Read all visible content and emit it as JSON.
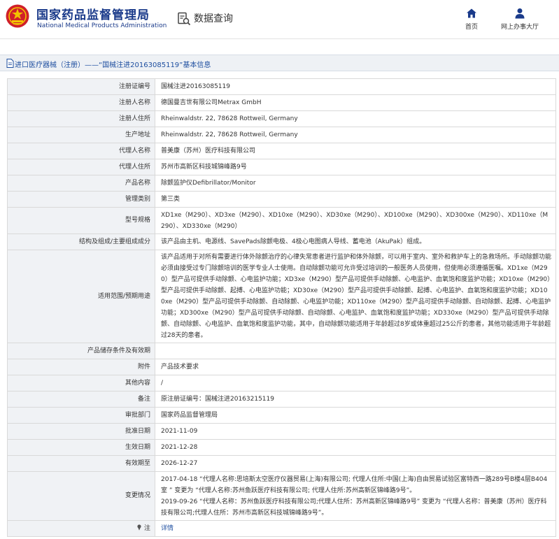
{
  "header": {
    "brand_cn": "国家药品监督管理局",
    "brand_en": "National Medical Products Administration",
    "query_title": "数据查询",
    "nav": [
      {
        "label": "首页",
        "icon": "home-icon"
      },
      {
        "label": "网上办事大厅",
        "icon": "user-icon"
      }
    ]
  },
  "title_bar": {
    "text": "进口医疗器械（注册）——“国械注进20163085119”基本信息"
  },
  "colors": {
    "brand": "#1a3a8a",
    "link": "#1f4fa0",
    "label_bg": "#f0f2f5",
    "border": "#d9d9d9",
    "logo_red": "#d0202a"
  },
  "rows": [
    {
      "label": "注册证编号",
      "value": "国械注进20163085119"
    },
    {
      "label": "注册人名称",
      "value": "德国曼吉世有限公司Metrax GmbH"
    },
    {
      "label": "注册人住所",
      "value": "Rheinwaldstr. 22, 78628 Rottweil, Germany"
    },
    {
      "label": "生产地址",
      "value": "Rheinwaldstr. 22, 78628 Rottweil, Germany"
    },
    {
      "label": "代理人名称",
      "value": "普美康（苏州）医疗科技有限公司"
    },
    {
      "label": "代理人住所",
      "value": "苏州市高新区科技城锦峰路9号"
    },
    {
      "label": "产品名称",
      "value": "除颤监护仪Defibrillator/Monitor"
    },
    {
      "label": "管理类别",
      "value": "第三类"
    },
    {
      "label": "型号规格",
      "value": "XD1xe（M290）、XD3xe（M290）、XD10xe（M290）、XD30xe（M290）、XD100xe（M290）、XD300xe（M290）、XD110xe（M290）、XD330xe（M290）"
    },
    {
      "label": "结构及组成/主要组成成分",
      "value": "该产品由主机、电源线、SavePads除颤电极、4极心电图病人导线、蓄电池（AkuPak）组成。"
    },
    {
      "label": "适用范围/预期用途",
      "value": "该产品适用于对所有需要进行体外除颤治疗的心律失常患者进行监护和体外除颤，可以用于室内、室外和救护车上的急救场所。手动除颤功能必须由接受过专门除颤培训的医学专业人士使用。自动除颤功能可允许受过培训的一般医务人员使用，但使用必须遵循医嘱。XD1xe（M290）型产品可提供手动除颤、心电监护功能；XD3xe（M290）型产品可提供手动除颤、心电监护、血氧饱和度监护功能；XD10xe（M290）型产品可提供手动除颤、起搏、心电监护功能；XD30xe（M290）型产品可提供手动除颤、起搏、心电监护、血氧饱和度监护功能；XD100xe（M290）型产品可提供手动除颤、自动除颤、心电监护功能；XD110xe（M290）型产品可提供手动除颤、自动除颤、起搏、心电监护功能；XD300xe（M290）型产品可提供手动除颤、自动除颤、心电监护、血氧饱和度监护功能；XD330xe（M290）型产品可提供手动除颤、自动除颤、心电监护、血氧饱和度监护功能，其中，自动除颤功能适用于年龄超过8岁或体重超过25公斤的患者，其他功能适用于年龄超过28天的患者。"
    },
    {
      "label": "产品储存条件及有效期",
      "value": ""
    },
    {
      "label": "附件",
      "value": "产品技术要求"
    },
    {
      "label": "其他内容",
      "value": "/"
    },
    {
      "label": "备注",
      "value": "原注册证编号：国械注进20163215119"
    },
    {
      "label": "审批部门",
      "value": "国家药品监督管理局"
    },
    {
      "label": "批准日期",
      "value": "2021-11-09"
    },
    {
      "label": "生效日期",
      "value": "2021-12-28"
    },
    {
      "label": "有效期至",
      "value": "2026-12-27"
    },
    {
      "label": "变更情况",
      "value": "2017-04-18 “代理人名称:思培斯太空医疗仪器贸易(上海)有限公司; 代理人住所:中国(上海)自由贸易试验区富特西一路289号B楼4层B404室 ” 变更为 “代理人名称:苏州鱼跃医疗科技有限公司; 代理人住所:苏州高新区锦峰路9号”。\n2019-09-26 “代理人名称：苏州鱼跃医疗科技有限公司;代理人住所：苏州高新区锦峰路9号” 变更为 “代理人名称：普美康（苏州）医疗科技有限公司;代理人住所：苏州市高新区科技城锦峰路9号”。"
    }
  ],
  "note_row": {
    "label": "注",
    "link": "详情",
    "icon": "pin-icon"
  }
}
